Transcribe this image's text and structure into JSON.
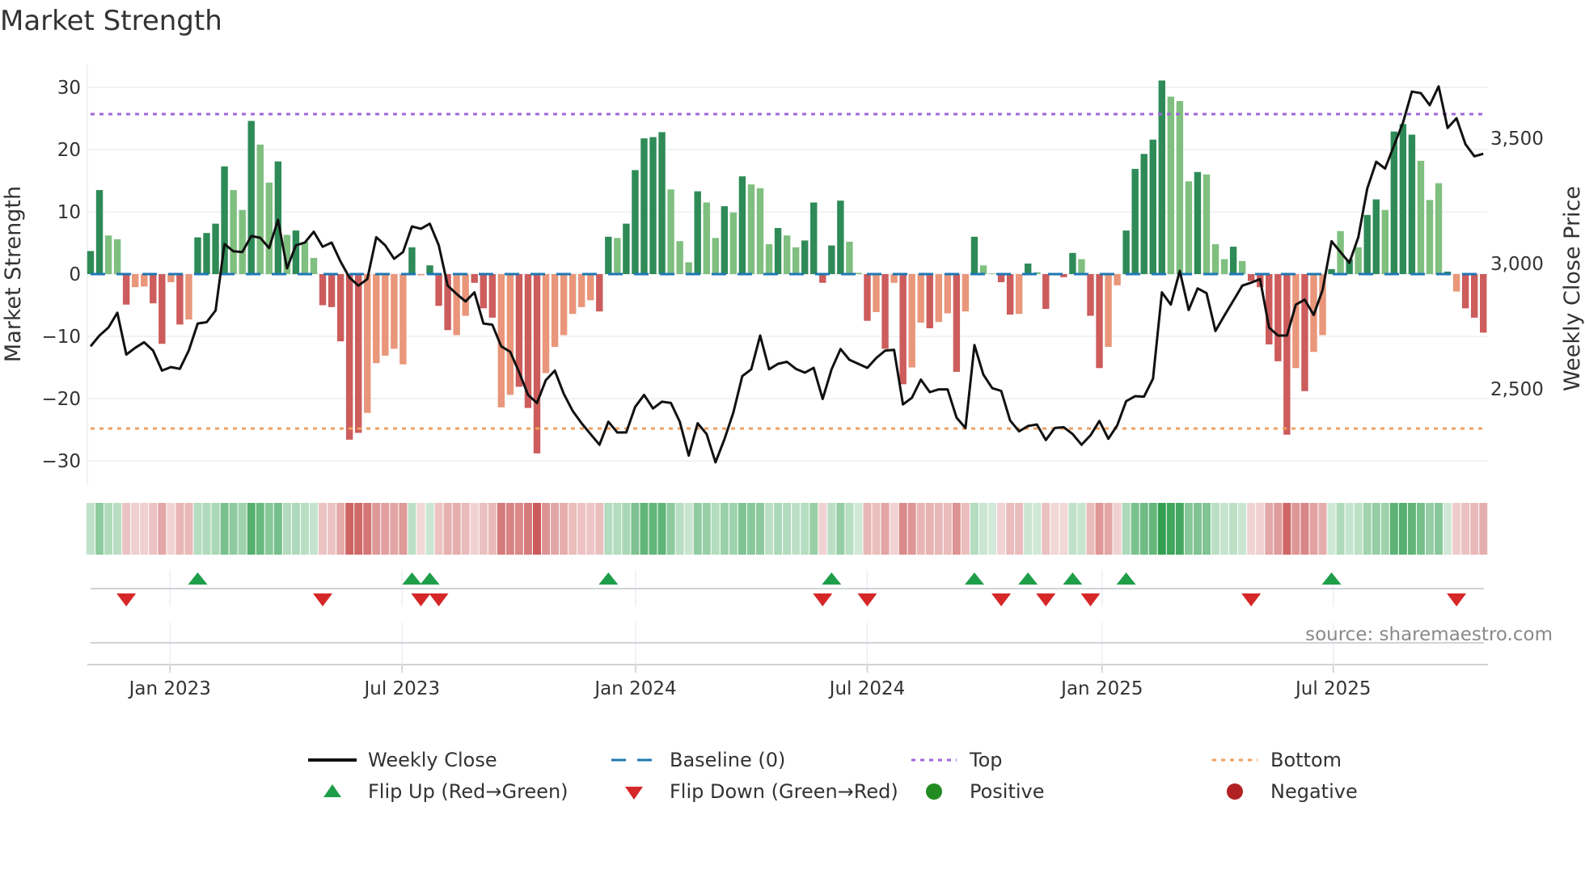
{
  "title": "Market Strength",
  "source": "source: sharemaestro.com",
  "chart_data": {
    "type": "bar",
    "title": "Market Strength",
    "ylabel": "Market Strength",
    "y2label": "Weekly Close Price",
    "ylim": [
      -34,
      33
    ],
    "y_ticks": [
      30,
      20,
      10,
      0,
      -10,
      -20,
      -30
    ],
    "y_tick_labels": [
      "30",
      "20",
      "10",
      "0",
      "−10",
      "−20",
      "−30"
    ],
    "y2_ticks": [
      3500,
      3000,
      2500
    ],
    "y2_tick_labels": [
      "3,500",
      "3,000",
      "2,500"
    ],
    "x_ticks": [
      {
        "week": 8.9,
        "label": "Jan 2023"
      },
      {
        "week": 34.9,
        "label": "Jul 2023"
      },
      {
        "week": 61.05,
        "label": "Jan 2024"
      },
      {
        "week": 87.0,
        "label": "Jul 2024"
      },
      {
        "week": 113.3,
        "label": "Jan 2025"
      },
      {
        "week": 139.2,
        "label": "Jul 2025"
      }
    ],
    "top_level": 25.7,
    "bottom_level": -24.8,
    "baseline": 0,
    "strength": [
      3.7,
      13.5,
      6.2,
      5.6,
      -4.9,
      -2.1,
      -2.0,
      -4.7,
      -11.2,
      -1.3,
      -8.1,
      -7.3,
      5.9,
      6.6,
      8.1,
      17.3,
      13.5,
      10.3,
      24.6,
      20.8,
      14.7,
      18.1,
      6.3,
      7.0,
      5.2,
      2.6,
      -5.0,
      -5.3,
      -10.8,
      -26.6,
      -25.5,
      -22.3,
      -14.3,
      -13.1,
      -12.0,
      -14.5,
      4.3,
      -0.2,
      1.4,
      -5.1,
      -9.0,
      -9.8,
      -6.7,
      -1.4,
      -5.5,
      -7.0,
      -21.4,
      -19.4,
      -18.1,
      -21.5,
      -28.8,
      -15.9,
      -11.7,
      -9.8,
      -6.4,
      -5.3,
      -4.2,
      -6.0,
      6.0,
      5.8,
      8.1,
      16.7,
      21.8,
      22.0,
      22.8,
      13.6,
      5.3,
      1.9,
      13.3,
      11.5,
      5.8,
      10.9,
      9.9,
      15.7,
      14.4,
      13.8,
      4.8,
      7.4,
      6.2,
      4.3,
      5.4,
      11.5,
      -1.4,
      4.6,
      11.8,
      5.2,
      0.2,
      -7.5,
      -6.1,
      -12.0,
      -1.4,
      -17.7,
      -15.0,
      -7.8,
      -8.7,
      -7.7,
      -6.3,
      -15.7,
      -6.0,
      6.0,
      1.4,
      0.1,
      -1.3,
      -6.5,
      -6.4,
      1.7,
      0.3,
      -5.6,
      -0.2,
      -0.5,
      3.4,
      2.4,
      -6.7,
      -15.1,
      -11.7,
      -1.8,
      7.0,
      16.9,
      19.3,
      21.6,
      31.1,
      28.5,
      27.8,
      14.9,
      16.4,
      16.0,
      4.8,
      2.4,
      4.4,
      2.1,
      -1.1,
      -2.1,
      -11.3,
      -14.0,
      -25.8,
      -15.1,
      -18.8,
      -12.5,
      -9.8,
      0.8,
      6.9,
      2.4,
      4.3,
      9.5,
      12.0,
      10.3,
      22.9,
      24.1,
      22.4,
      18.2,
      11.9,
      14.6,
      0.4,
      -2.8,
      -5.5,
      -7.0,
      -9.4
    ],
    "shades": "ddllldllddldlddddlldlldldlldddd",
    "shade_codes": "ddlldllddldlddddlldlldldlldddddllllldldddlldddlldddllllllddldddddllldlldldllldlldddddlldldldlldlldldllddldldlddlddlldddddllldllldldddddldlldldlddldddllldldddd",
    "weekly_close": [
      2670,
      2713,
      2745,
      2804,
      2637,
      2664,
      2686,
      2653,
      2573,
      2587,
      2580,
      2653,
      2761,
      2766,
      2813,
      3078,
      3049,
      3046,
      3110,
      3103,
      3062,
      3175,
      2981,
      3073,
      3084,
      3127,
      3067,
      3084,
      3008,
      2944,
      2912,
      2938,
      3105,
      3073,
      3019,
      3046,
      3148,
      3139,
      3159,
      3073,
      2912,
      2879,
      2849,
      2885,
      2761,
      2756,
      2670,
      2648,
      2567,
      2476,
      2444,
      2535,
      2573,
      2481,
      2412,
      2363,
      2320,
      2277,
      2369,
      2326,
      2326,
      2428,
      2476,
      2422,
      2449,
      2444,
      2369,
      2234,
      2363,
      2320,
      2207,
      2299,
      2406,
      2551,
      2578,
      2713,
      2578,
      2600,
      2608,
      2580,
      2565,
      2584,
      2460,
      2578,
      2659,
      2616,
      2600,
      2584,
      2623,
      2653,
      2656,
      2438,
      2465,
      2537,
      2487,
      2498,
      2498,
      2385,
      2344,
      2675,
      2557,
      2503,
      2492,
      2374,
      2331,
      2352,
      2358,
      2296,
      2344,
      2347,
      2320,
      2277,
      2315,
      2372,
      2301,
      2355,
      2451,
      2471,
      2469,
      2541,
      2885,
      2836,
      2971,
      2815,
      2901,
      2882,
      2731,
      2793,
      2852,
      2912,
      2924,
      2938,
      2745,
      2713,
      2713,
      2836,
      2856,
      2795,
      2895,
      3089,
      3046,
      3003,
      3105,
      3299,
      3406,
      3379,
      3471,
      3562,
      3686,
      3680,
      3632,
      3707,
      3541,
      3580,
      3476,
      3428,
      3438
    ],
    "legend": [
      {
        "key": "close",
        "label": "Weekly Close"
      },
      {
        "key": "baseline",
        "label": "Baseline (0)"
      },
      {
        "key": "top",
        "label": "Top"
      },
      {
        "key": "bottom",
        "label": "Bottom"
      },
      {
        "key": "flip_up",
        "label": "Flip Up (Red→Green)"
      },
      {
        "key": "flip_down",
        "label": "Flip Down (Green→Red)"
      },
      {
        "key": "positive",
        "label": "Positive"
      },
      {
        "key": "negative",
        "label": "Negative"
      }
    ],
    "legend_position": "bottom",
    "grid": true
  },
  "colors": {
    "pos_dark": "#2e8b57",
    "pos_light": "#7fbf7f",
    "neg_dark": "#cd5c5c",
    "neg_light": "#e9967a",
    "close": "#111111",
    "baseline": "#1f77b4",
    "top": "#a066e0",
    "bottom": "#f0a060",
    "flip_up": "#1f9e4a",
    "flip_down": "#d62728",
    "positive": "#228b22",
    "negative": "#b22222",
    "grid": "#eceff3"
  }
}
